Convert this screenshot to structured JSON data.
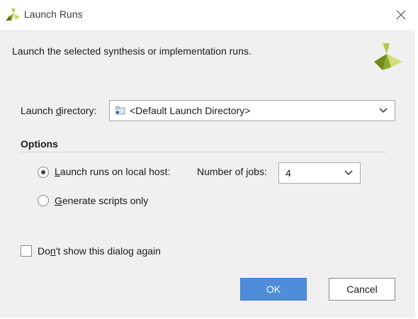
{
  "window": {
    "title": "Launch Runs",
    "close_icon": "close-icon"
  },
  "intro_text": "Launch the selected synthesis or implementation runs.",
  "launch_directory": {
    "label_pre": "Launch ",
    "label_underline": "d",
    "label_post": "irectory:",
    "value": "<Default Launch Directory>"
  },
  "options": {
    "title": "Options",
    "local_host": {
      "label_underline": "L",
      "label_post": "aunch runs on local host:",
      "checked": true
    },
    "jobs": {
      "label_pre": "Number of ",
      "label_underline": "j",
      "label_post": "obs:",
      "value": "4"
    },
    "scripts_only": {
      "label_underline": "G",
      "label_post": "enerate scripts only",
      "checked": false
    }
  },
  "dont_show": {
    "label_pre": "Do",
    "label_underline": "n",
    "label_post": "'t show this dialog again",
    "checked": false
  },
  "buttons": {
    "ok": "OK",
    "cancel": "Cancel"
  },
  "colors": {
    "accent": "#4f8ddb",
    "logo_green": "#8aac2a",
    "logo_dark": "#5a6e12"
  }
}
